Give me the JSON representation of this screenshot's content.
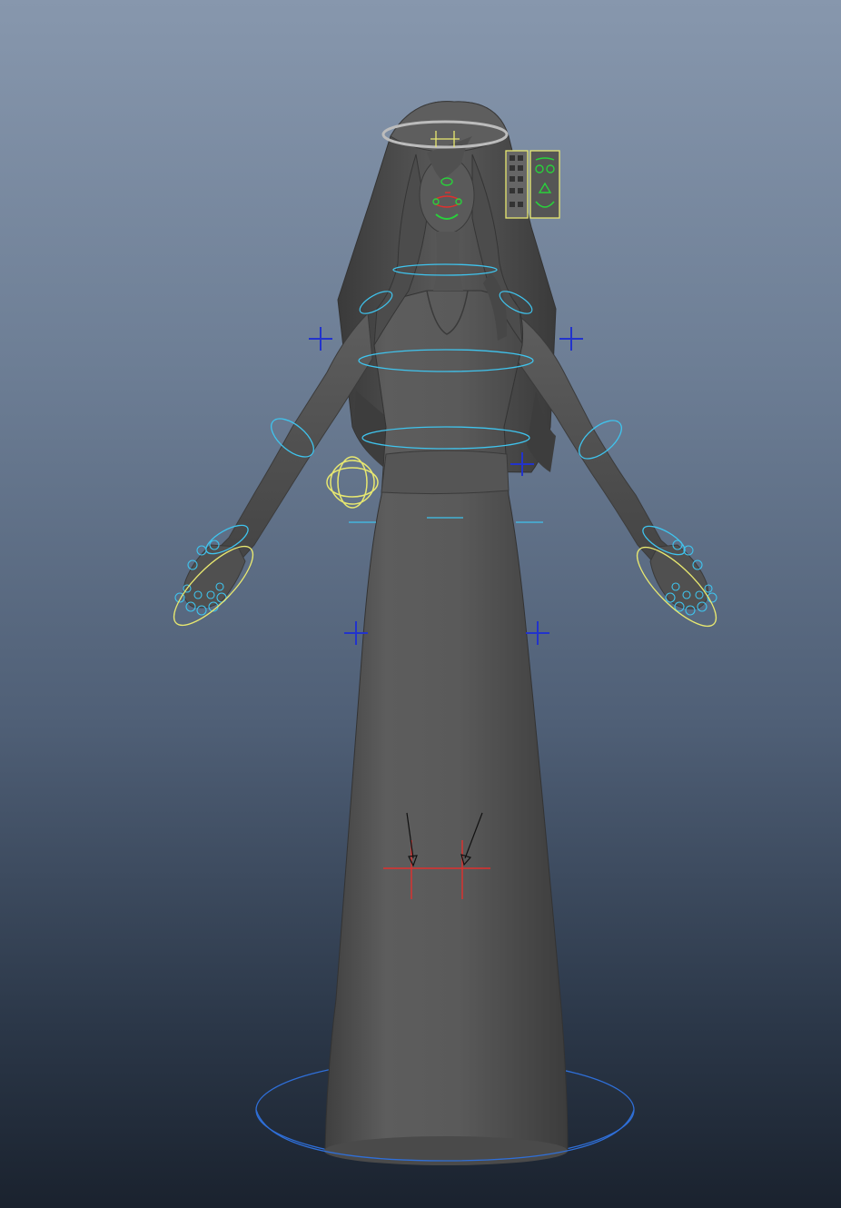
{
  "viewport": {
    "background_top": "#8797ad",
    "background_bottom": "#1a222e",
    "mesh_color": "#5b5b5b",
    "control_cyan": "#3fc4ee",
    "control_blue": "#2233cc",
    "control_yellow": "#e8e870",
    "control_green": "#29d13b",
    "control_red": "#e0302e"
  },
  "scene": {
    "object": "character-model",
    "rig_controls": [
      "head-control",
      "face-controls",
      "face-ui-panel",
      "neck-control",
      "chest-control",
      "waist-control",
      "hip-control",
      "shoulder-left-control",
      "shoulder-right-control",
      "elbow-left-control",
      "elbow-right-control",
      "wrist-left-control",
      "wrist-right-control",
      "finger-controls",
      "hand-ik-left-control",
      "hand-ik-right-control",
      "pole-vector-left",
      "pole-vector-right",
      "knee-locator-left",
      "knee-locator-right",
      "root-control",
      "cog-control"
    ]
  }
}
